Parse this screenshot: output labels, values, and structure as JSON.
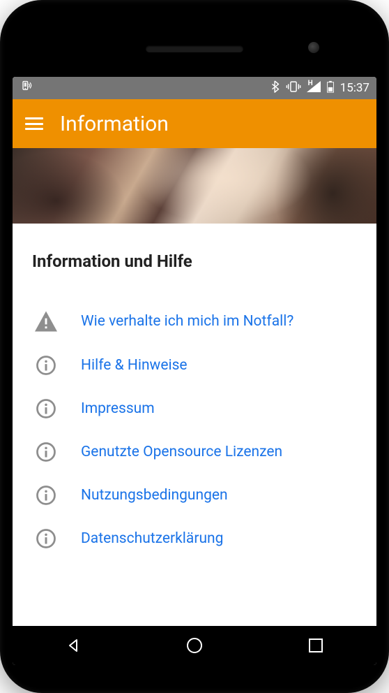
{
  "status": {
    "time": "15:37",
    "network_label": "H"
  },
  "action_bar": {
    "title": "Information"
  },
  "section": {
    "title": "Information und Hilfe"
  },
  "items": [
    {
      "icon": "warning",
      "label": "Wie verhalte ich mich im Notfall?"
    },
    {
      "icon": "info",
      "label": "Hilfe & Hinweise"
    },
    {
      "icon": "info",
      "label": "Impressum"
    },
    {
      "icon": "info",
      "label": "Genutzte Opensource Lizenzen"
    },
    {
      "icon": "info",
      "label": "Nutzungsbedingungen"
    },
    {
      "icon": "info",
      "label": "Datenschutzerklärung"
    }
  ],
  "colors": {
    "accent": "#ef9000",
    "link": "#1a73e8",
    "icon_grey": "#8e8e8e"
  }
}
